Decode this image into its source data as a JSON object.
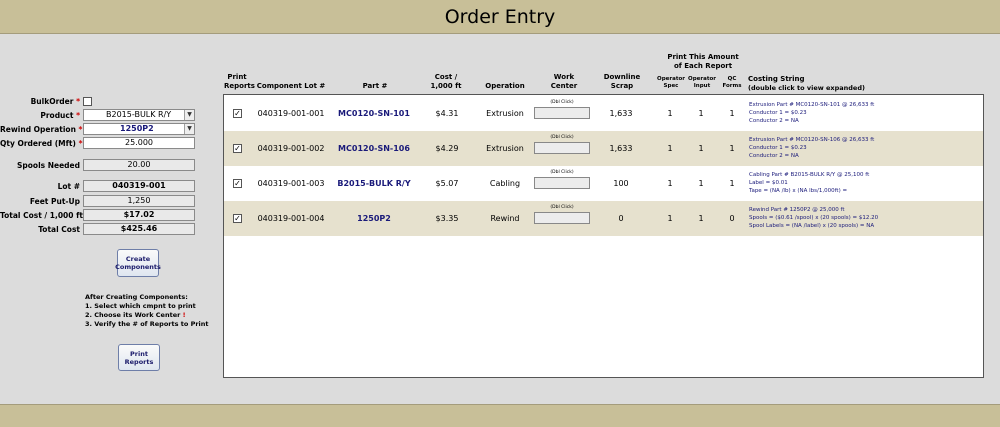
{
  "window": {
    "title": "Order Entry"
  },
  "form": {
    "bulk_order": {
      "label": "BulkOrder",
      "required_mark": "*"
    },
    "product": {
      "label": "Product",
      "required_mark": "*",
      "value": "B2015-BULK R/Y"
    },
    "rewind_operation": {
      "label": "Rewind Operation",
      "required_mark": "*",
      "value": "1250P2"
    },
    "qty_ordered": {
      "label": "Qty Ordered (Mft)",
      "required_mark": "*",
      "value": "25.000"
    },
    "spools_needed": {
      "label": "Spools Needed",
      "value": "20.00"
    },
    "lot": {
      "label": "Lot #",
      "value": "040319-001"
    },
    "feet_put_up": {
      "label": "Feet Put-Up",
      "value": "1,250"
    },
    "total_cost_per_1000": {
      "label": "Total Cost / 1,000 ft",
      "value": "$17.02"
    },
    "total_cost": {
      "label": "Total Cost",
      "value": "$425.46"
    },
    "create_components_button": "Create Components",
    "instructions": {
      "heading": "After Creating Components:",
      "step1": "1. Select which cmpnt to print",
      "step2": "2. Choose its Work Center",
      "step2_mark": "!",
      "step3": "3. Verify the # of Reports to Print"
    },
    "print_reports_button": "Print Reports"
  },
  "grid": {
    "headers": {
      "print_reports": "Print Reports",
      "component_lot": "Component Lot #",
      "part": "Part #",
      "cost": "Cost / 1,000 ft",
      "operation": "Operation",
      "work_center": "Work Center",
      "downline_scrap": "Downline Scrap",
      "print_amount_group": "Print This Amount of Each Report",
      "operator_spec": "Operator Spec",
      "operator_input": "Operator Input",
      "qc_forms": "QC Forms",
      "costing_string_1": "Costing String",
      "costing_string_2": "(double click to view expanded)"
    },
    "dbl_click_hint": "(Dbl Click)",
    "rows": [
      {
        "checked": "✓",
        "component_lot": "040319-001-001",
        "part": "MC0120-SN-101",
        "cost": "$4.31",
        "operation": "Extrusion",
        "downline_scrap": "1,633",
        "operator_spec": "1",
        "operator_input": "1",
        "qc_forms": "1",
        "costing": [
          "Extrusion Part # MC0120-SN-101 @ 26,633 ft",
          "Conductor 1 = $0.23",
          "Conductor 2 = NA"
        ]
      },
      {
        "checked": "✓",
        "component_lot": "040319-001-002",
        "part": "MC0120-SN-106",
        "cost": "$4.29",
        "operation": "Extrusion",
        "downline_scrap": "1,633",
        "operator_spec": "1",
        "operator_input": "1",
        "qc_forms": "1",
        "costing": [
          "Extrusion Part # MC0120-SN-106 @ 26,633 ft",
          "Conductor 1 = $0.23",
          "Conductor 2 = NA"
        ]
      },
      {
        "checked": "✓",
        "component_lot": "040319-001-003",
        "part": "B2015-BULK R/Y",
        "cost": "$5.07",
        "operation": "Cabling",
        "downline_scrap": "100",
        "operator_spec": "1",
        "operator_input": "1",
        "qc_forms": "1",
        "costing": [
          "Cabling Part # B2015-BULK R/Y @ 25,100 ft",
          "Label = $0.01",
          "Tape = (NA /lb) x (NA lbs/1,000ft) ="
        ]
      },
      {
        "checked": "✓",
        "component_lot": "040319-001-004",
        "part": "1250P2",
        "cost": "$3.35",
        "operation": "Rewind",
        "downline_scrap": "0",
        "operator_spec": "1",
        "operator_input": "1",
        "qc_forms": "0",
        "costing": [
          "Rewind Part # 1250P2 @ 25,000 ft",
          "Spools = ($0.61 /spool) x (20 spools) = $12.20",
          "Spool Labels = (NA /label) x (20 spools) = NA"
        ]
      }
    ]
  }
}
